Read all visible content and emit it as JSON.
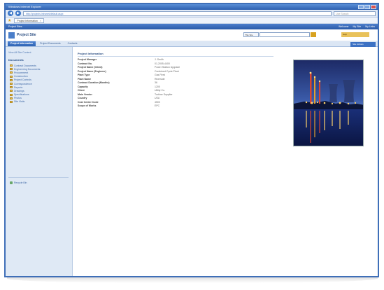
{
  "browser": {
    "title": "Windows Internet Explorer",
    "url": "http://projects.intranet/default.aspx",
    "search_placeholder": "Live Search",
    "tab_label": "Project Information"
  },
  "topbar": {
    "site_label": "Project Sites",
    "welcome": "Welcome",
    "my_site": "My Site",
    "my_links": "My Links"
  },
  "site": {
    "title": "Project Site",
    "scope": "This Site",
    "help": "Help"
  },
  "topnav": {
    "tabs": [
      "Project Information",
      "Project Documents",
      "Contacts"
    ],
    "site_actions": "Site Actions"
  },
  "leftnav": {
    "view_all": "View All Site Content",
    "section": "Documents",
    "items": [
      "Contract Documents",
      "Engineering Documents",
      "Procurement",
      "Construction",
      "Project Controls",
      "Correspondence",
      "Reports",
      "Drawings",
      "Specifications",
      "Photos",
      "Site Visits"
    ],
    "recycle_bin": "Recycle Bin"
  },
  "project": {
    "title": "Project Information",
    "fields": [
      {
        "label": "Project Manager",
        "value": "J. Smith"
      },
      {
        "label": "Contract No.",
        "value": "01-2005-4400"
      },
      {
        "label": "Project Name (Client)",
        "value": "Power Station Upgrade"
      },
      {
        "label": "Project Name (Engineer)",
        "value": "Combined Cycle Plant"
      },
      {
        "label": "Plant Type",
        "value": "Gas Fired"
      },
      {
        "label": "Plant Name",
        "value": "Riverside"
      },
      {
        "label": "Contract Duration (Months)",
        "value": "36"
      },
      {
        "label": "Capacity",
        "value": "1200"
      },
      {
        "label": "Client",
        "value": "Utility Co."
      },
      {
        "label": "Main Vendor",
        "value": "Turbine Supplier"
      },
      {
        "label": "Country",
        "value": "USA"
      },
      {
        "label": "Cost Center Code",
        "value": "4500"
      },
      {
        "label": "Scope of Works",
        "value": "EPC"
      }
    ]
  },
  "colors": {
    "brand": "#2c5fb0",
    "nav_bg": "#dfe9f5"
  }
}
